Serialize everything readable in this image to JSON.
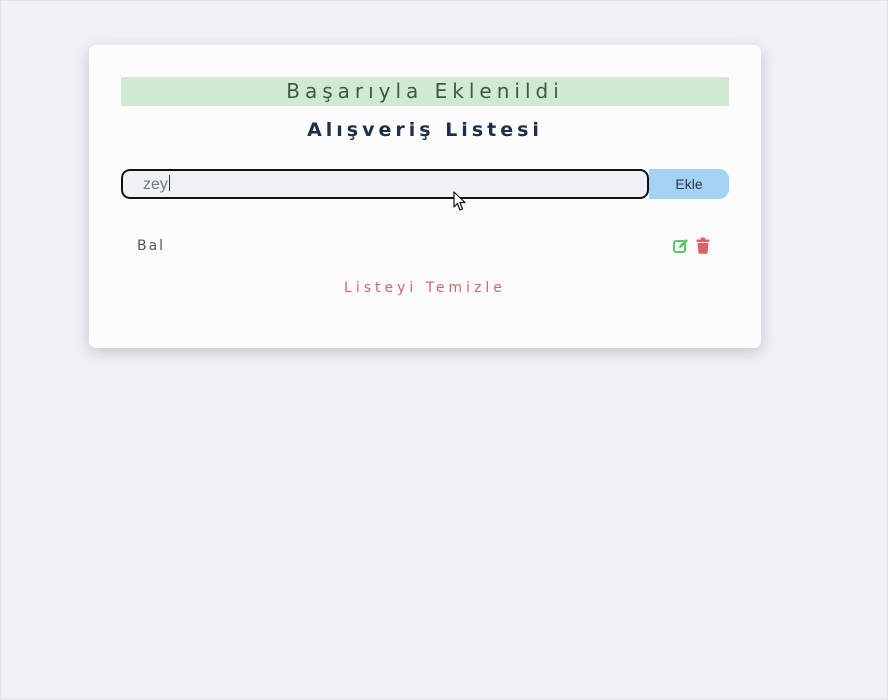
{
  "alert": {
    "message": "Başarıyla Eklenildi",
    "color": "#d3e8d3"
  },
  "header": {
    "title": "Alışveriş Listesi"
  },
  "form": {
    "input_value": "zey",
    "submit_label": "Ekle",
    "submit_color": "#a3d2f4"
  },
  "list": {
    "items": [
      {
        "label": "Bal",
        "edit_icon": "edit-icon",
        "delete_icon": "trash-icon"
      }
    ]
  },
  "actions": {
    "clear_label": "Listeyi Temizle",
    "clear_color": "#d06666"
  },
  "colors": {
    "background": "#eef1f5",
    "edit": "#5bc86b",
    "delete": "#e05f66"
  }
}
